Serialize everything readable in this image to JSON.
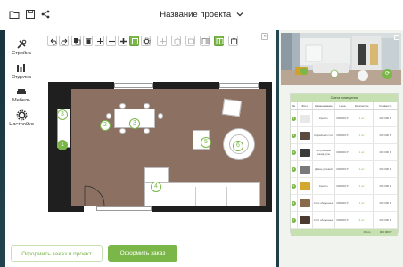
{
  "app": {
    "project_title": "Название проекта",
    "toolbar_icons": [
      "folder-icon",
      "save-icon",
      "share-icon"
    ]
  },
  "tools": [
    {
      "label": "Стройка",
      "icon": "tools-icon"
    },
    {
      "label": "Отделка",
      "icon": "paint-roller-icon"
    },
    {
      "label": "Мебель",
      "icon": "sofa-icon"
    },
    {
      "label": "Настройки",
      "icon": "gear-icon"
    }
  ],
  "plan_markers": [
    "1",
    "2",
    "3",
    "4",
    "5",
    "6"
  ],
  "buttons": {
    "order_in_project": "Оформить заказ в проект",
    "order": "Оформить заказ"
  },
  "estimate": {
    "title": "Смета помещения",
    "columns": [
      "№",
      "Фото",
      "Наименование",
      "Цена",
      "Количество",
      "Стоимость"
    ],
    "rows": [
      {
        "n": "1",
        "name": "Кресло",
        "price": "000 000 Р",
        "qty": "1 шт",
        "total": "000 000 Р",
        "color": "#e8e8e8"
      },
      {
        "n": "2",
        "name": "Кофейный стол",
        "price": "000 000 Р",
        "qty": "1 шт",
        "total": "000 000 Р",
        "color": "#5a4a40"
      },
      {
        "n": "3",
        "name": "Встроенный шкаф-купе",
        "price": "000 000 Р",
        "qty": "1 шт",
        "total": "000 000 Р",
        "color": "#3a3a3a"
      },
      {
        "n": "4",
        "name": "Диван угловой",
        "price": "000 000 Р",
        "qty": "1 шт",
        "total": "000 000 Р",
        "color": "#7a7a7a"
      },
      {
        "n": "5",
        "name": "Кресло",
        "price": "000 000 Р",
        "qty": "1 шт",
        "total": "000 000 Р",
        "color": "#d4a82e"
      },
      {
        "n": "6",
        "name": "Стол обеденный",
        "price": "000 000 Р",
        "qty": "1 шт",
        "total": "000 000 Р",
        "color": "#8a6a4a"
      },
      {
        "n": "7",
        "name": "Стул обеденный",
        "price": "000 000 Р",
        "qty": "4 шт",
        "total": "000 000 Р",
        "color": "#4a3a30"
      }
    ],
    "total_label": "Итого",
    "total_value": "000 000 Р"
  },
  "colors": {
    "accent": "#7ab648",
    "floor": "#8c7163",
    "wall": "#1f1f1f"
  }
}
